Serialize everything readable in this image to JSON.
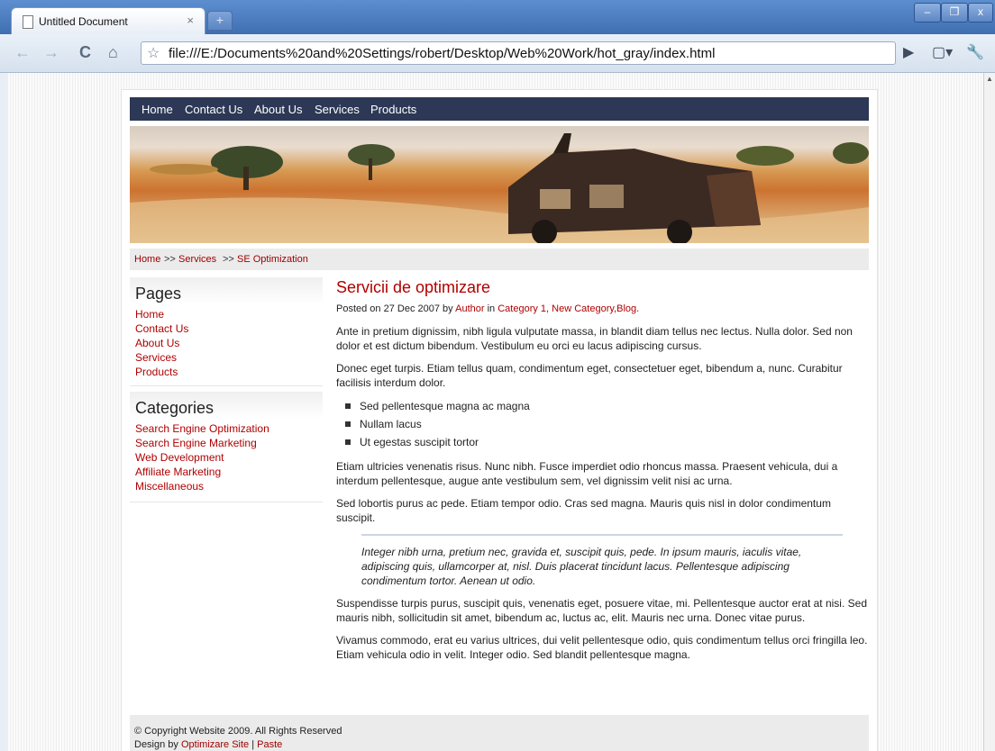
{
  "browser": {
    "tab_title": "Untitled Document",
    "tab_close": "×",
    "new_tab": "+",
    "url": "file:///E:/Documents%20and%20Settings/robert/Desktop/Web%20Work/hot_gray/index.html",
    "icons": [
      "back-icon",
      "forward-icon",
      "reload-icon",
      "home-icon",
      "star-icon",
      "play-icon",
      "page-menu-icon",
      "wrench-icon"
    ]
  },
  "site": {
    "nav": [
      "Home",
      "Contact Us",
      "About Us",
      "Services",
      "Products"
    ],
    "breadcrumb": {
      "home": "Home",
      "sep1": ">>",
      "services": "Services",
      "sep2": ">>",
      "current": "SE Optimization"
    },
    "sidebar": {
      "pages_title": "Pages",
      "pages": [
        "Home",
        "Contact Us",
        "About Us",
        "Services",
        "Products"
      ],
      "categories_title": "Categories",
      "categories": [
        "Search Engine Optimization",
        "Search Engine Marketing",
        "Web Development",
        "Affiliate Marketing",
        "Miscellaneous"
      ]
    },
    "post": {
      "title": "Servicii de optimizare",
      "meta_prefix": "Posted on 27 Dec 2007 by",
      "author": "Author",
      "meta_in": "in",
      "cat1": "Category 1",
      "cat2": "New Category",
      "cat3": "Blog.",
      "p1": "Ante in pretium dignissim, nibh ligula vulputate massa, in blandit diam tellus nec lectus. Nulla dolor. Sed non dolor et est dictum bibendum. Vestibulum eu orci eu lacus adipiscing cursus.",
      "p2": "Donec eget turpis. Etiam tellus quam, condimentum eget, consectetuer eget, bibendum a, nunc. Curabitur facilisis interdum dolor.",
      "list": [
        "Sed pellentesque magna ac magna",
        "Nullam lacus",
        "Ut egestas suscipit tortor"
      ],
      "p3": "Etiam ultricies venenatis risus. Nunc nibh. Fusce imperdiet odio rhoncus massa. Praesent vehicula, dui a interdum pellentesque, augue ante vestibulum sem, vel dignissim velit nisi ac urna.",
      "p4": "Sed lobortis purus ac pede. Etiam tempor odio. Cras sed magna. Mauris quis nisl in dolor condimentum suscipit.",
      "quote": "Integer nibh urna, pretium nec, gravida et, suscipit quis, pede. In ipsum mauris, iaculis vitae, adipiscing quis, ullamcorper at, nisl. Duis placerat tincidunt lacus. Pellentesque adipiscing condimentum tortor. Aenean ut odio.",
      "p5": "Suspendisse turpis purus, suscipit quis, venenatis eget, posuere vitae, mi. Pellentesque auctor erat at nisi. Sed mauris nibh, sollicitudin sit amet, bibendum ac, luctus ac, elit. Mauris nec urna. Donec vitae purus.",
      "p6": "Vivamus commodo, erat eu varius ultrices, dui velit pellentesque odio, quis condimentum tellus orci fringilla leo. Etiam vehicula odio in velit. Integer odio. Sed blandit pellentesque magna."
    },
    "footer": {
      "copyright": "© Copyright Website 2009. All Rights Reserved",
      "design_by": "Design by",
      "design_link": "Optimizare Site",
      "sep": "|",
      "paste": "Paste"
    }
  },
  "colors": {
    "nav_bg": "#2c3855",
    "link_red": "#b00000",
    "bar_gray": "#ebebeb"
  }
}
